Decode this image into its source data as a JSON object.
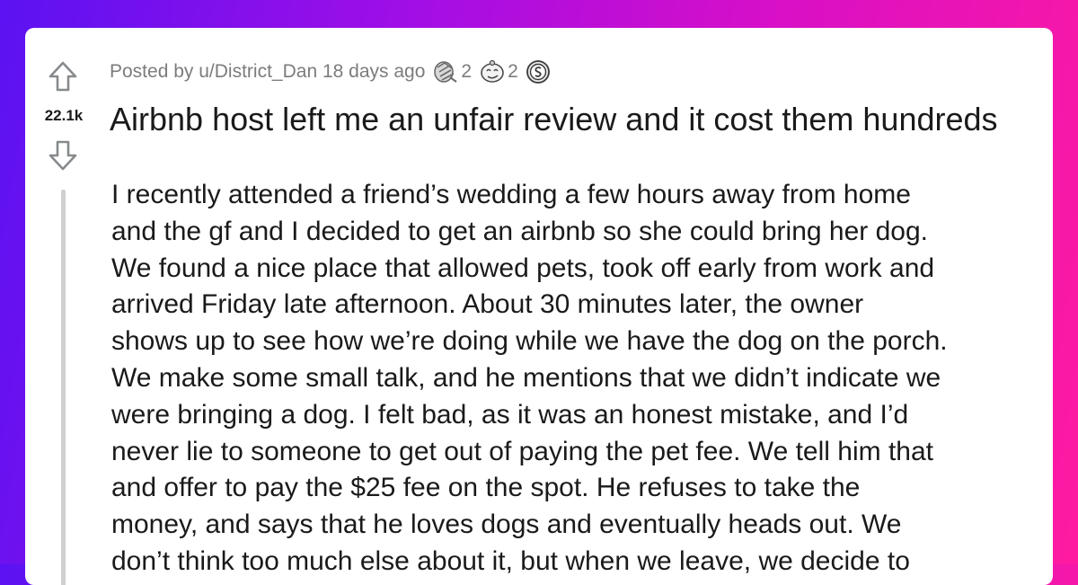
{
  "post": {
    "posted_by_prefix": "Posted by",
    "username": "u/District_Dan",
    "age": "18 days ago",
    "awards": [
      {
        "icon": "award-hands-icon",
        "count": "2"
      },
      {
        "icon": "award-face-icon",
        "count": "2"
      },
      {
        "icon": "award-coin-icon",
        "count": ""
      }
    ],
    "score": "22.1k",
    "title": "Airbnb host left me an unfair review and it cost them hundreds",
    "body_lines": [
      "I recently attended a friend’s wedding a few hours away from home",
      "and the gf and I decided to get an airbnb so she could bring her dog.",
      "We found a nice place that allowed pets, took off early from work and",
      "arrived Friday late afternoon. About 30 minutes later, the owner",
      "shows up to see how we’re doing while we have the dog on the porch.",
      "We make some small talk, and he mentions that we didn’t indicate we",
      "were bringing a dog. I felt bad, as it was an honest mistake, and I’d",
      "never lie to someone to get out of paying the pet fee. We tell him that",
      "and offer to pay the $25 fee on the spot. He refuses to take the",
      "money, and says that he loves dogs and eventually heads out. We",
      "don’t think too much else about it, but when we leave, we decide to"
    ]
  },
  "colors": {
    "background_gradient_start": "#5b12f2",
    "background_gradient_end": "#ff1aa0",
    "card": "#ffffff",
    "meta_text": "#7c7c7c",
    "body_text": "#1a1a1b"
  }
}
